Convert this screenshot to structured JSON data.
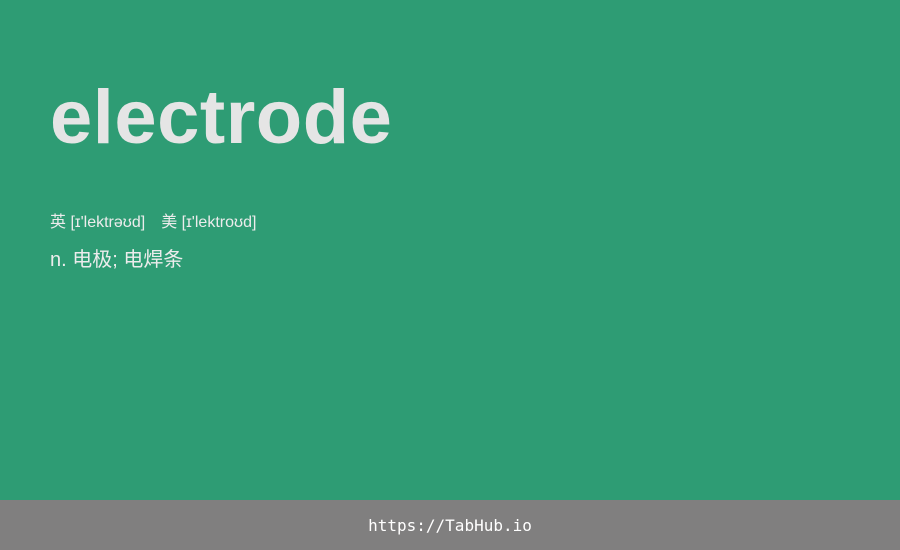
{
  "entry": {
    "word": "electrode",
    "phonetic_uk": "英 [ɪ'lektrəʊd]",
    "phonetic_us": "美 [ɪ'lektroʊd]",
    "definition": "n. 电极; 电焊条"
  },
  "footer": {
    "link_text": "https://TabHub.io"
  },
  "colors": {
    "background": "#2e9c74",
    "footer_bar": "#807f7f",
    "text": "#e5e5e5"
  }
}
